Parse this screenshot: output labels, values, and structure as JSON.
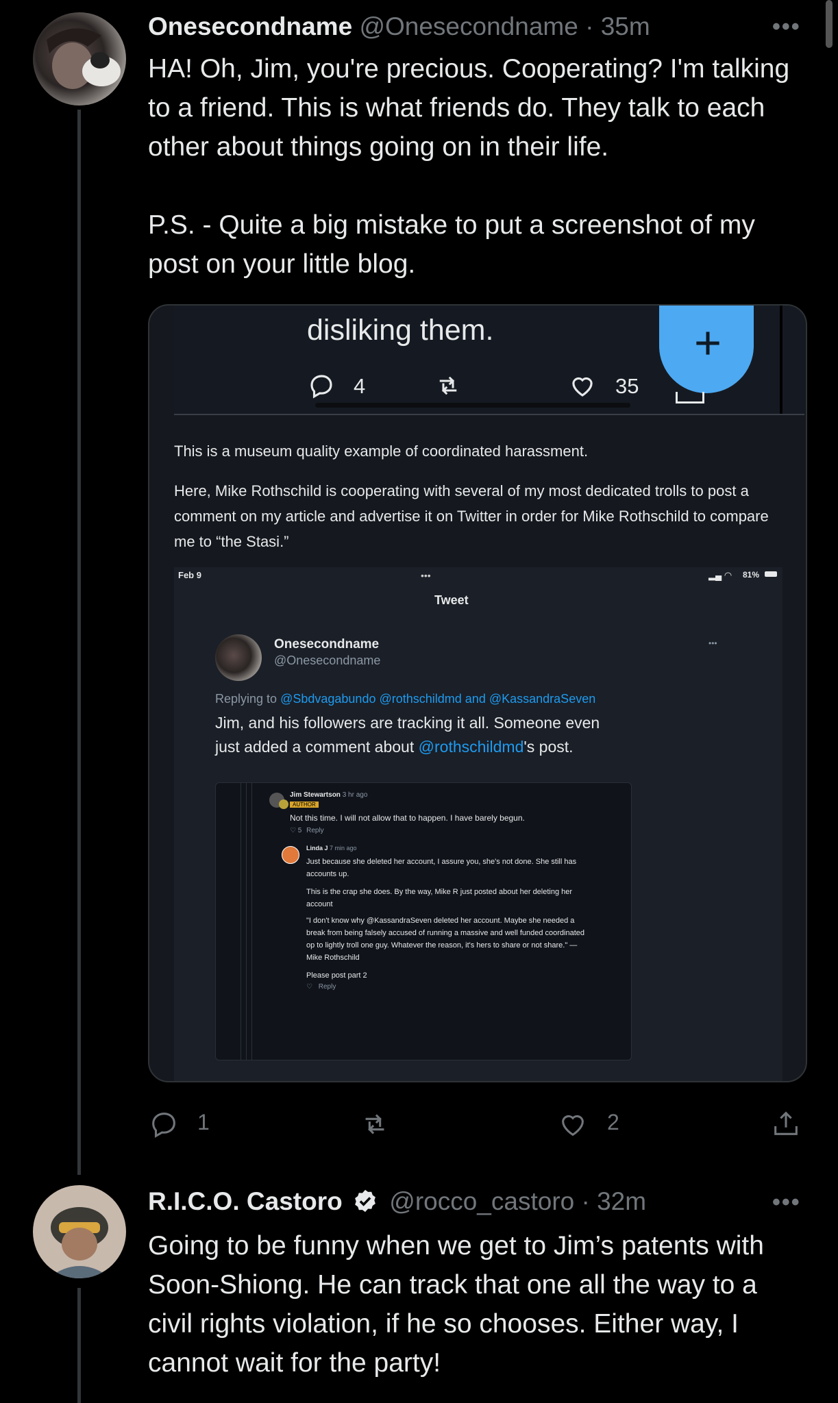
{
  "tweet1": {
    "display_name": "Onesecondname",
    "handle": "@Onesecondname",
    "time": "· 35m",
    "text": "HA! Oh, Jim, you're precious. Cooperating? I'm talking to a friend. This is what friends do. They talk to each other about things going on in their life.\n\nP.S. - Quite a big mistake to put a screenshot of my post on your little blog.",
    "more_icon": "more-horizontal-icon",
    "replies": "1",
    "likes": "2"
  },
  "embedded": {
    "top_text": "disliking them.",
    "top_replies": "4",
    "top_likes": "35",
    "fab_icon": "plus",
    "para1": "This is a museum quality example of coordinated harassment.",
    "para2": "Here, Mike Rothschild is cooperating with several of my most dedicated trolls to post a comment on my article and advertise it on Twitter in order for Mike Rothschild to compare me to “the Stasi.”",
    "phone": {
      "date": "Feb 9",
      "dots": "•••",
      "status": "81%",
      "title": "Tweet",
      "name": "Onesecondname",
      "handle": "@Onesecondname",
      "replying_label": "Replying to",
      "replying_handles": "@Sbdvagabundo @rothschildmd",
      "replying_and": "and",
      "replying_last": "@KassandraSeven",
      "body_pre": "Jim, and his followers are tracking it all. Someone even just added a comment about ",
      "body_mention": "@rothschildmd",
      "body_post": "'s post.",
      "comments": {
        "c1_name": "Jim Stewartson",
        "c1_time": "3 hr ago",
        "c1_badge": "AUTHOR",
        "c1_text": "Not this time. I will not allow that to happen. I have barely begun.",
        "c1_likes": "5",
        "c1_reply": "Reply",
        "c2_name": "Linda J",
        "c2_time": "7 min ago",
        "c2_p1": "Just because she deleted her account, I assure you, she's not done. She still has accounts up.",
        "c2_p2": "This is the crap she does. By the way, Mike R just posted about her deleting her account",
        "c2_p3": "\"I don't know why @KassandraSeven deleted her account. Maybe she needed a break from being falsely accused of running a massive and well funded coordinated op to lightly troll one guy. Whatever the reason, it's hers to share or not share.\" — Mike Rothschild",
        "c2_p4": "Please post part 2",
        "c2_reply": "Reply"
      }
    }
  },
  "tweet2": {
    "display_name": "R.I.C.O. Castoro",
    "handle": "@rocco_castoro",
    "time": "· 32m",
    "text": "Going to be funny when we get to Jim’s patents with Soon-Shiong. He can track that one all the way to a civil rights violation, if he so chooses. Either way, I cannot wait for the party!"
  },
  "colors": {
    "accent": "#1d9bf0",
    "muted": "#71767b",
    "text": "#e7e9ea",
    "bg": "#000000"
  }
}
